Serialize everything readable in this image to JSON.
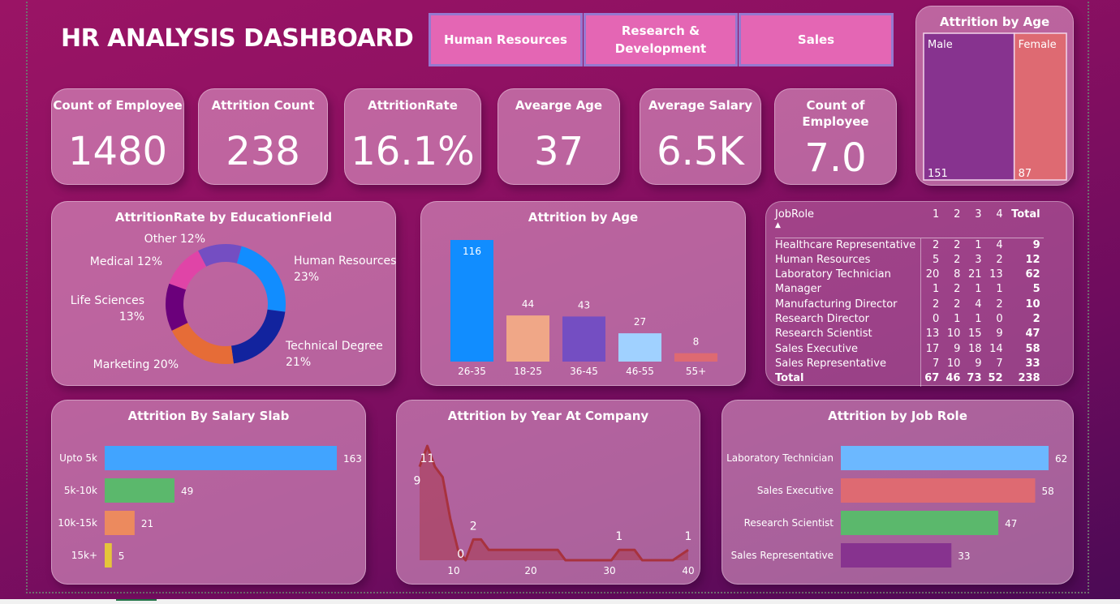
{
  "header": {
    "title": "HR ANALYSIS DASHBOARD"
  },
  "slicers": [
    {
      "label": "Human Resources"
    },
    {
      "label": "Research &\nDevelopment"
    },
    {
      "label": "Sales"
    }
  ],
  "kpis": [
    {
      "label": "Count of Employee",
      "value": "1480"
    },
    {
      "label": "Attrition Count",
      "value": "238"
    },
    {
      "label": "AttritionRate",
      "value": "16.1%"
    },
    {
      "label": "Avearge Age",
      "value": "37"
    },
    {
      "label": "Average Salary",
      "value": "6.5K"
    },
    {
      "label": "Count of Employee",
      "value": "7.0"
    }
  ],
  "colors": {
    "slicer_bg": "#e466b4",
    "slicer_border": "#9678d0",
    "male": "#87338f",
    "female": "#de6a72"
  },
  "jobrole_matrix": {
    "header": {
      "role": "JobRole",
      "cols": [
        "1",
        "2",
        "3",
        "4"
      ],
      "total": "Total"
    },
    "rows": [
      {
        "role": "Healthcare Representative",
        "vals": [
          "2",
          "2",
          "1",
          "4"
        ],
        "total": "9"
      },
      {
        "role": "Human Resources",
        "vals": [
          "5",
          "2",
          "3",
          "2"
        ],
        "total": "12"
      },
      {
        "role": "Laboratory Technician",
        "vals": [
          "20",
          "8",
          "21",
          "13"
        ],
        "total": "62"
      },
      {
        "role": "Manager",
        "vals": [
          "1",
          "2",
          "1",
          "1"
        ],
        "total": "5"
      },
      {
        "role": "Manufacturing Director",
        "vals": [
          "2",
          "2",
          "4",
          "2"
        ],
        "total": "10"
      },
      {
        "role": "Research Director",
        "vals": [
          "0",
          "1",
          "1",
          "0"
        ],
        "total": "2"
      },
      {
        "role": "Research Scientist",
        "vals": [
          "13",
          "10",
          "15",
          "9"
        ],
        "total": "47"
      },
      {
        "role": "Sales Executive",
        "vals": [
          "17",
          "9",
          "18",
          "14"
        ],
        "total": "58"
      },
      {
        "role": "Sales Representative",
        "vals": [
          "7",
          "10",
          "9",
          "7"
        ],
        "total": "33"
      }
    ],
    "total_row": {
      "role": "Total",
      "vals": [
        "67",
        "46",
        "73",
        "52"
      ],
      "total": "238"
    }
  },
  "chart_data": [
    {
      "id": "gender",
      "type": "treemap",
      "title": "Attrition by Age",
      "categories": [
        "Male",
        "Female"
      ],
      "values": [
        151,
        87
      ],
      "colors": [
        "#87338f",
        "#de6a72"
      ]
    },
    {
      "id": "education",
      "type": "pie",
      "title": "AttritionRate by EducationField",
      "categories": [
        "Human Resources",
        "Technical Degree",
        "Marketing",
        "Life Sciences",
        "Medical",
        "Other"
      ],
      "values": [
        23,
        21,
        20,
        13,
        12,
        12
      ],
      "labels": [
        "Human Resources\n23%",
        "Technical Degree\n21%",
        "Marketing 20%",
        "Life Sciences\n13%",
        "Medical 12%",
        "Other 12%"
      ],
      "colors": [
        "#118dff",
        "#12239e",
        "#e66c37",
        "#6b007b",
        "#e044a7",
        "#744ec2"
      ],
      "donut": true
    },
    {
      "id": "age",
      "type": "bar",
      "title": "Attrition by Age",
      "categories": [
        "26-35",
        "18-25",
        "36-45",
        "46-55",
        "55+"
      ],
      "values": [
        116,
        44,
        43,
        27,
        8
      ],
      "colors": [
        "#118dff",
        "#f0a787",
        "#744ec2",
        "#a0d1ff",
        "#de6a72"
      ],
      "ylim": [
        0,
        116
      ]
    },
    {
      "id": "salary",
      "type": "bar",
      "orientation": "horizontal",
      "title": "Attrition By Salary Slab",
      "categories": [
        "Upto 5k",
        "5k-10k",
        "10k-15k",
        "15k+"
      ],
      "values": [
        163,
        49,
        21,
        5
      ],
      "colors": [
        "#41a4ff",
        "#5bb86c",
        "#ec8a5e",
        "#e5c53a"
      ],
      "xlim": [
        0,
        163
      ]
    },
    {
      "id": "years",
      "type": "area",
      "title": "Attrition by Year At Company",
      "x": [
        0,
        1,
        2,
        3,
        4,
        5,
        6,
        7,
        8,
        9,
        10,
        11,
        12,
        13,
        14,
        15,
        16,
        17,
        18,
        19,
        20,
        21,
        22,
        23,
        24,
        25,
        26,
        27,
        28,
        29,
        30,
        31,
        32,
        33,
        34,
        35,
        36,
        37,
        38,
        39,
        40
      ],
      "values": [
        9,
        11,
        9,
        8,
        4,
        1,
        0,
        2,
        2,
        1,
        1,
        1,
        1,
        1,
        1,
        1,
        1,
        1,
        1,
        0,
        0,
        0,
        0,
        0,
        0,
        0,
        1,
        1,
        1,
        0,
        0,
        0,
        0,
        0,
        0.5,
        1,
        null,
        null,
        null,
        null,
        null
      ],
      "point_labels": [
        {
          "x": 0,
          "label": "9"
        },
        {
          "x": 1,
          "label": "11"
        },
        {
          "x": 6,
          "label": "0"
        },
        {
          "x": 7,
          "label": "2"
        },
        {
          "x": 26,
          "label": "1"
        },
        {
          "x": 35,
          "label": "1"
        }
      ],
      "x_ticks": [
        "10",
        "20",
        "30",
        "40"
      ],
      "color": "#a8323e"
    },
    {
      "id": "jobrole",
      "type": "bar",
      "orientation": "horizontal",
      "title": "Attrition by Job Role",
      "categories": [
        "Laboratory Technician",
        "Sales Executive",
        "Research Scientist",
        "Sales Representative"
      ],
      "values": [
        62,
        58,
        47,
        33
      ],
      "colors": [
        "#6cb8ff",
        "#de6a72",
        "#5bb86c",
        "#87338f"
      ],
      "xlim": [
        0,
        62
      ]
    }
  ]
}
